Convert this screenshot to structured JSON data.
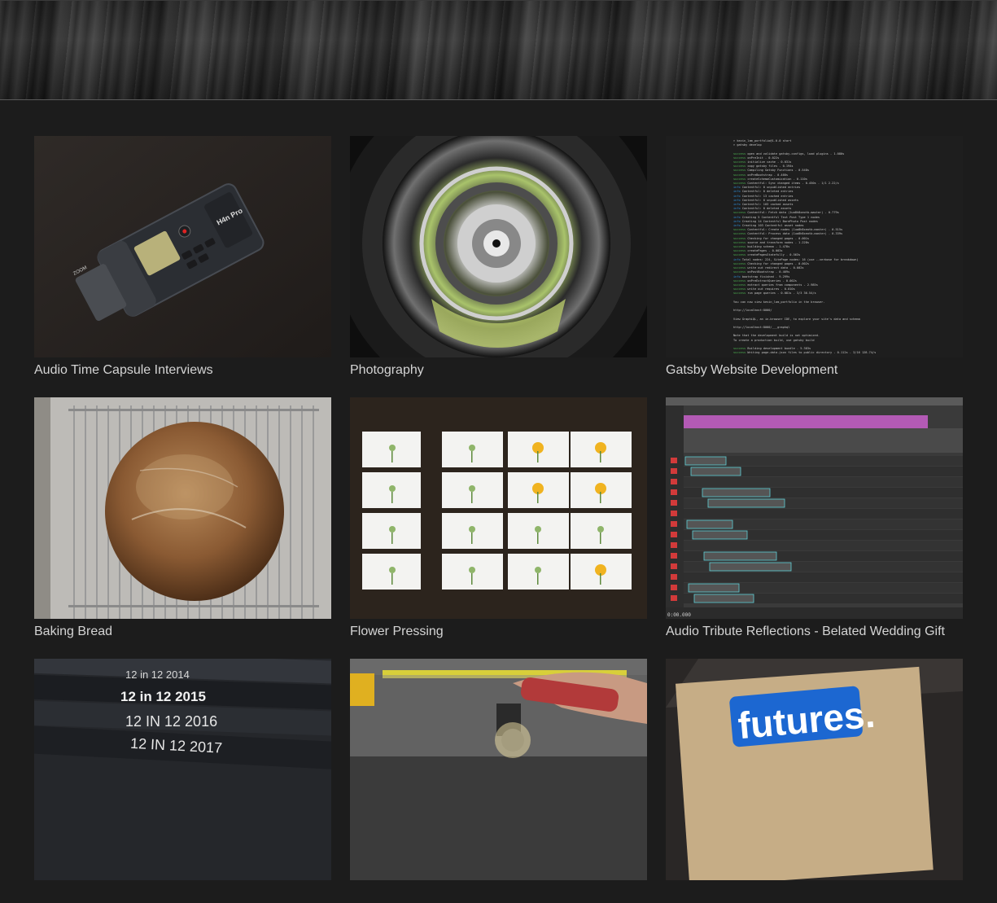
{
  "projects": [
    {
      "title": "Audio Time Capsule Interviews",
      "thumb_icon": "audio-recorder-photo"
    },
    {
      "title": "Photography",
      "thumb_icon": "camera-lens-photo"
    },
    {
      "title": "Gatsby Website Development",
      "thumb_icon": "terminal-screenshot"
    },
    {
      "title": "Baking Bread",
      "thumb_icon": "bread-loaf-photo"
    },
    {
      "title": "Flower Pressing",
      "thumb_icon": "pressed-flowers-photo"
    },
    {
      "title": "Audio Tribute Reflections - Belated Wedding Gift",
      "thumb_icon": "audio-editor-screenshot"
    },
    {
      "title": "",
      "thumb_icon": "dvd-cases-photo"
    },
    {
      "title": "",
      "thumb_icon": "power-tool-photo"
    },
    {
      "title": "",
      "thumb_icon": "futures-sign-photo"
    }
  ],
  "thumbs": {
    "dvd_labels": [
      "12 in 12 2014",
      "12 in 12 2015",
      "12 IN 12 2016",
      "12 IN 12  2017"
    ],
    "futures_text": "futures.",
    "recorder": {
      "brand": "ZOOM",
      "model": "H4n Pro"
    },
    "daw": {
      "timecode": "0:00.000"
    },
    "terminal_lines": [
      "> kevin_lam_portfolio@1.0.0 start",
      "> gatsby develop",
      "",
      "success open and validate gatsby-configs, load plugins - 1.080s",
      "success onPreInit - 0.022s",
      "success initialize cache - 0.031s",
      "success copy gatsby files - 0.194s",
      "success Compiling Gatsby Functions - 0.548s",
      "success onPreBootstrap - 0.466s",
      "success createSchemaCustomization - 0.110s",
      "success Contentful: Sync changed items - 0.450s - 1/1 2.22/s",
      "info Contentful: 0 unpublished entries",
      "info Contentful: 0 deleted entries",
      "info Contentful: 13 cached entries",
      "info Contentful: 0 unpublished assets",
      "info Contentful: 103 cached assets",
      "info Contentful: 0 deleted assets",
      "success Contentful: Fetch data (1ua8h8xeotb-master) - 0.779s",
      "info Creating 5 Contentful Text Post Type 1 nodes",
      "info Creating 14 Contentful BarePhoto Post nodes",
      "info Creating 103 Contentful asset nodes",
      "success Contentful: Create nodes (1ua8h8xeotb-master) - 0.515s",
      "success Contentful: Process data (1ua8h8xeotb-master) - 0.339s",
      "success Checking for changed pages - 0.001s",
      "success source and transform nodes - 1.228s",
      "success building schema - 1.478s",
      "success createPages - 0.003s",
      "success createPagesStatefully - 0.563s",
      "info Total nodes: 224, SitePage nodes: 16 (use --verbose for breakdown)",
      "success Checking for changed pages - 0.002s",
      "success write out redirect data - 0.002s",
      "success onPostBootstrap - 0.469s",
      "info bootstrap finished - 9.299s",
      "success onPreExtractQueries - 0.002s",
      "success extract queries from components - 2.985s",
      "success write out requires - 0.010s",
      "success run page queries - 0.081s - 3/3 36.54/s",
      "",
      "You can now view kevin_lam_portfolio in the browser.",
      "",
      "  http://localhost:8000/",
      "",
      "View GraphiQL, an in-browser IDE, to explore your site's data and schema",
      "",
      "  http://localhost:8000/___graphql",
      "",
      "Note that the development build is not optimized.",
      "To create a production build, use gatsby build",
      "",
      "success Building development bundle - 5.383s",
      "success Writing page-data.json files to public directory - 0.112s - 3/16 128.74/s"
    ]
  }
}
